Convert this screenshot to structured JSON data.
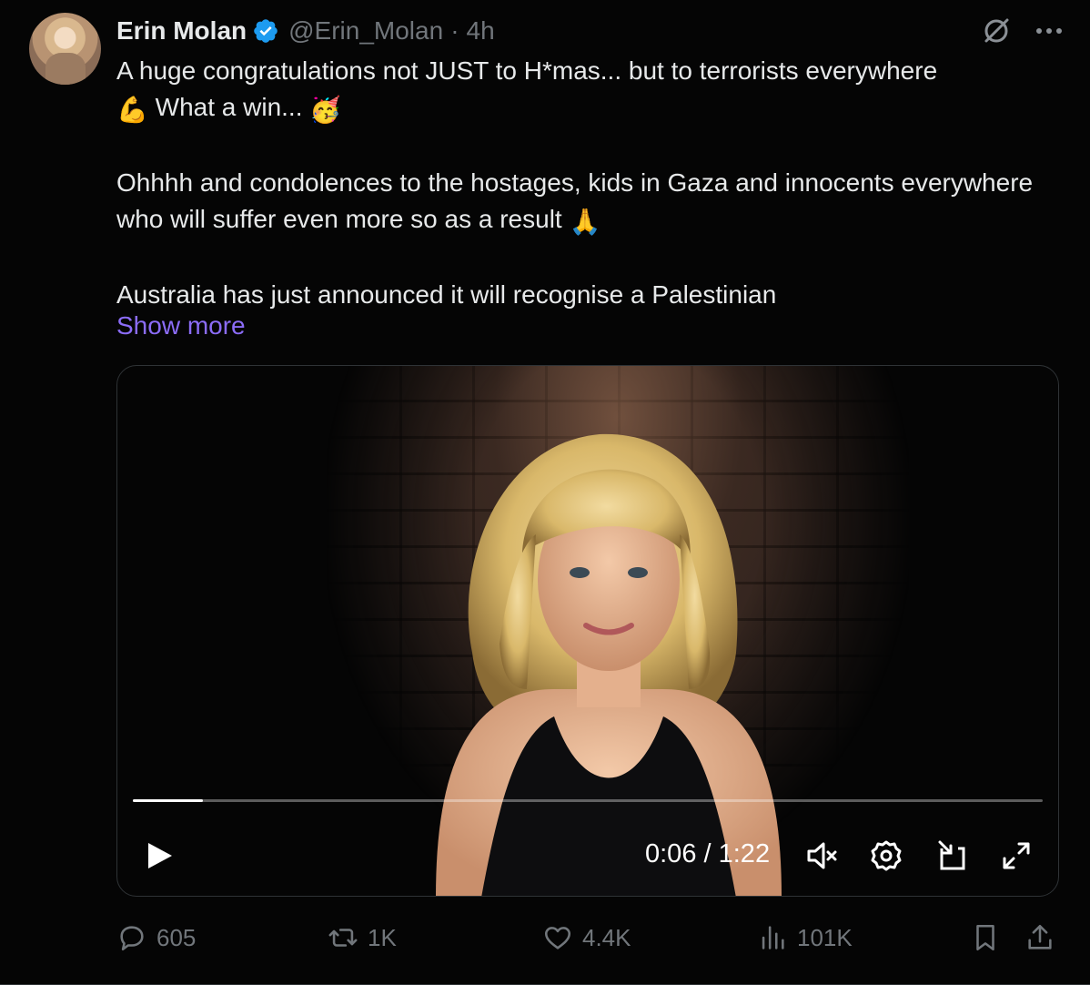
{
  "tweet": {
    "author_name": "Erin Molan",
    "handle": "@Erin_Molan",
    "separator": "·",
    "time": "4h",
    "body": {
      "p1_text": "A huge congratulations not JUST to H*mas... but to terrorists everywhere",
      "p1_emoji1": "💪",
      "p1_text2": "What a win...",
      "p1_emoji2": "🥳",
      "p2_text": "Ohhhh and condolences to the hostages, kids in Gaza and innocents everywhere who will suffer even more so as a result",
      "p2_emoji": "🙏",
      "p3_text": "Australia has just announced it will recognise a Palestinian"
    },
    "show_more": "Show more"
  },
  "video": {
    "current_time": "0:06",
    "duration": "1:22",
    "time_separator": " / ",
    "progress_fraction": 0.077
  },
  "actions": {
    "replies": "605",
    "reposts": "1K",
    "likes": "4.4K",
    "views": "101K"
  },
  "colors": {
    "background": "#050505",
    "text": "#e7e9ea",
    "secondary": "#71767b",
    "link": "#8b6cf7",
    "verified": "#1d9bf0"
  }
}
